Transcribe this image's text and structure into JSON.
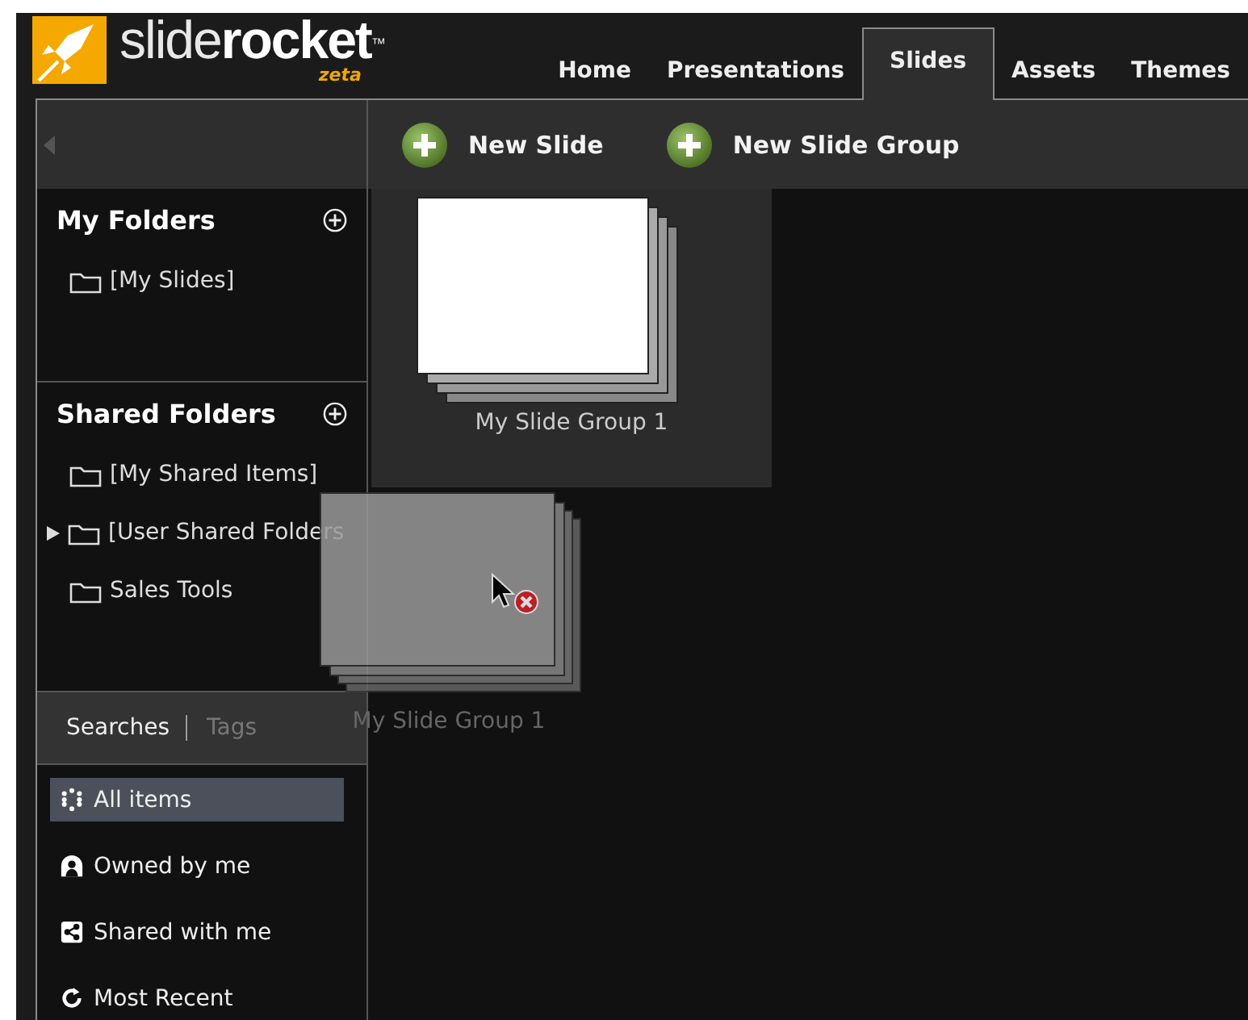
{
  "logo": {
    "name_light": "slide",
    "name_bold": "rocket",
    "trademark": "™",
    "edition": "zeta"
  },
  "nav_tabs": [
    {
      "label": "Home",
      "selected": false
    },
    {
      "label": "Presentations",
      "selected": false
    },
    {
      "label": "Slides",
      "selected": true
    },
    {
      "label": "Assets",
      "selected": false
    },
    {
      "label": "Themes",
      "selected": false
    }
  ],
  "toolbar": {
    "buttons": [
      "New Slide",
      "New Slide Group"
    ]
  },
  "sidebar": {
    "sections": [
      {
        "title": "My Folders",
        "folders": [
          {
            "label": "[My Slides]",
            "expandable": false
          }
        ]
      },
      {
        "title": "Shared Folders",
        "folders": [
          {
            "label": "[My Shared Items]",
            "expandable": false
          },
          {
            "label": "[User Shared Folders",
            "expandable": true
          },
          {
            "label": "Sales Tools",
            "expandable": false
          }
        ]
      }
    ],
    "search_tabs": [
      {
        "label": "Searches",
        "selected": true
      },
      {
        "label": "Tags",
        "selected": false
      }
    ],
    "searches": [
      {
        "label": "All items",
        "kind": "all",
        "selected": true
      },
      {
        "label": "Owned by me",
        "kind": "owned",
        "selected": false
      },
      {
        "label": "Shared with me",
        "kind": "shared",
        "selected": false
      },
      {
        "label": "Most Recent",
        "kind": "recent",
        "selected": false
      }
    ]
  },
  "slide_groups": [
    {
      "label": "My Slide Group 1",
      "selected": true
    }
  ],
  "drag_ghost": {
    "label": "My Slide Group 1",
    "drop_allowed": false
  }
}
